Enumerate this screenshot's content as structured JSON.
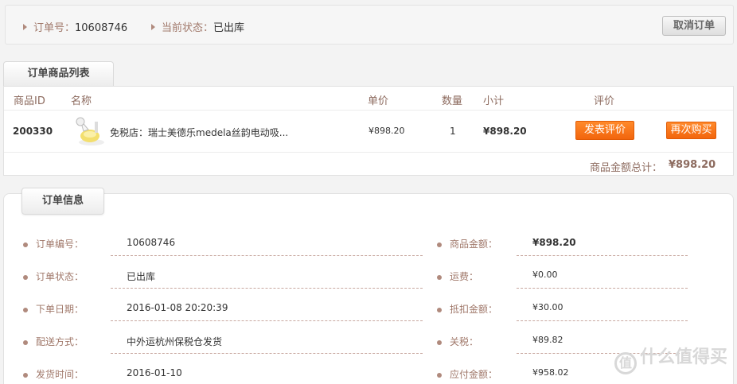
{
  "status_bar": {
    "order_no_label": "订单号：",
    "order_no": "10608746",
    "status_label": "当前状态：",
    "status": "已出库",
    "cancel_label": "取消订单"
  },
  "goods_section": {
    "tab_label": "订单商品列表",
    "columns": [
      "商品ID",
      "名称",
      "单价",
      "数量",
      "小计",
      "评价"
    ],
    "items": [
      {
        "id": "200330",
        "name": "免税店：瑞士美德乐medela丝韵电动吸...",
        "unit_price": "¥898.20",
        "qty": "1",
        "subtotal": "¥898.20",
        "review_label": "发表评价",
        "rebuy_label": "再次购买"
      }
    ],
    "total_label": "商品金额总计：",
    "total_value": "¥898.20"
  },
  "order_info": {
    "tab_label": "订单信息",
    "left": [
      {
        "label": "订单编号：",
        "value": "10608746"
      },
      {
        "label": "订单状态：",
        "value": "已出库"
      },
      {
        "label": "下单日期：",
        "value": "2016-01-08 20:20:39"
      },
      {
        "label": "配送方式：",
        "value": "中外运杭州保税仓发货"
      },
      {
        "label": "发货时间：",
        "value": "2016-01-10"
      }
    ],
    "right": [
      {
        "label": "商品金额：",
        "value": "¥898.20"
      },
      {
        "label": "运费：",
        "value": "¥0.00"
      },
      {
        "label": "抵扣金额：",
        "value": "¥30.00"
      },
      {
        "label": "关税：",
        "value": "¥89.82"
      },
      {
        "label": "应付金额：",
        "value": "¥958.02"
      }
    ]
  },
  "watermark": {
    "mark": "值",
    "text": "什么值得买"
  },
  "colors": {
    "accent_orange": "#f2650d",
    "label_brown": "#a0786a"
  }
}
